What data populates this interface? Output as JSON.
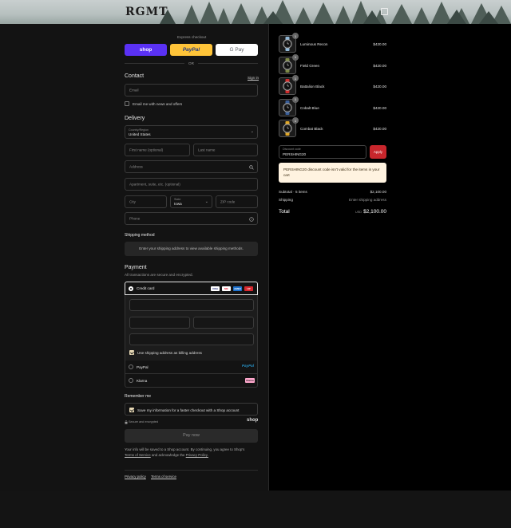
{
  "header": {
    "logo": "RGMT"
  },
  "express": {
    "title": "Express checkout",
    "or": "OR",
    "shop": "shop",
    "paypal": "PayPal",
    "gpay": "G Pay"
  },
  "contact": {
    "title": "Contact",
    "sign_in": "Sign in",
    "email_placeholder": "Email",
    "news_label": "Email me with news and offers"
  },
  "delivery": {
    "title": "Delivery",
    "country_label": "Country/Region",
    "country_value": "United States",
    "first_name": "First name (optional)",
    "last_name": "Last name",
    "address": "Address",
    "apartment": "Apartment, suite, etc. (optional)",
    "city": "City",
    "state_label": "State",
    "state_value": "Iowa",
    "zip": "ZIP code",
    "phone": "Phone"
  },
  "shipping_method": {
    "title": "Shipping method",
    "message": "Enter your shipping address to view available shipping methods."
  },
  "payment": {
    "title": "Payment",
    "subtitle": "All transactions are secure and encrypted.",
    "credit_card": "Credit card",
    "cards": [
      "VISA",
      "MC",
      "AMEX",
      "UP"
    ],
    "billing_label": "Use shipping address as billing address",
    "paypal": "PayPal",
    "klarna": "Klarna",
    "paypal_logo": "PayPal",
    "klarna_logo": "Klarna"
  },
  "remember": {
    "title": "Remember me",
    "save_label": "Save my information for a faster checkout with a Shop account",
    "secure": "Secure and encrypted",
    "shop_logo": "shop"
  },
  "pay_now": "Pay now",
  "legal": {
    "line1": "Your info will be saved to a Shop account. By continuing, you agree to Shop's",
    "terms": "Terms of Service",
    "and": "and acknowledge the",
    "privacy": "Privacy Policy."
  },
  "footer": {
    "privacy": "Privacy policy",
    "terms": "Terms of service"
  },
  "cart": {
    "items": [
      {
        "name": "Luminous Recon",
        "price": "$420.00",
        "qty": "1",
        "color": "#8fb8d8"
      },
      {
        "name": "Field Green",
        "price": "$420.00",
        "qty": "1",
        "color": "#7d8a45"
      },
      {
        "name": "Battalion Black",
        "price": "$420.00",
        "qty": "1",
        "color": "#d22b2b"
      },
      {
        "name": "Cobalt Blue",
        "price": "$420.00",
        "qty": "1",
        "color": "#3a5f9a"
      },
      {
        "name": "Combat Black",
        "price": "$420.00",
        "qty": "1",
        "color": "#e2a826"
      }
    ],
    "discount_label": "Discount code",
    "discount_value": "PERSHING20",
    "apply": "Apply",
    "discount_error": "PERSHING20 discount code isn't valid for the items in your cart",
    "subtotal_label": "Subtotal · 5 items",
    "subtotal": "$2,100.00",
    "shipping_label": "Shipping",
    "shipping_value": "Enter shipping address",
    "total_label": "Total",
    "currency": "USD",
    "total": "$2,100.00"
  }
}
